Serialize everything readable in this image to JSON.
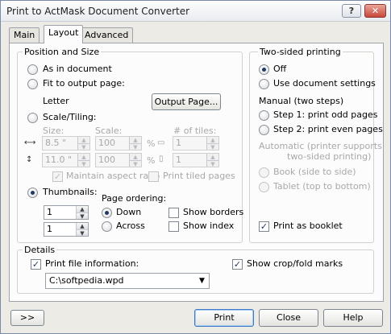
{
  "window": {
    "title": "Print to ActMask Document Converter",
    "help_label": "?",
    "close_label": "✕"
  },
  "tabs": [
    "Main",
    "Layout",
    "Advanced"
  ],
  "position_and_size": {
    "legend": "Position and Size",
    "as_in_document": "As in document",
    "fit_to_output_page": "Fit to output page:",
    "paper": "Letter",
    "output_page_button": "Output Page...",
    "scale_tiling": "Scale/Tiling:",
    "size_header": "Size:",
    "scale_header": "Scale:",
    "tiles_header": "# of tiles:",
    "width_value": "8.5 \"",
    "height_value": "11.0 \"",
    "scale_width_value": "100",
    "scale_height_value": "100",
    "percent_symbol": "%",
    "tiles_width_value": "1",
    "tiles_height_value": "1",
    "maintain_aspect_ratio": "Maintain aspect ratio",
    "print_tiled_pages": "Print tiled pages",
    "thumbnails": "Thumbnails:",
    "thumb_cols_value": "1",
    "thumb_rows_value": "1",
    "page_ordering": "Page ordering:",
    "down": "Down",
    "across": "Across",
    "show_borders": "Show borders",
    "show_index": "Show index"
  },
  "two_sided": {
    "legend": "Two-sided printing",
    "off": "Off",
    "use_document_settings": "Use document settings",
    "manual_header": "Manual (two steps)",
    "step1": "Step 1: print odd pages",
    "step2": "Step 2: print even pages",
    "automatic_line1": "Automatic (printer supports",
    "automatic_line2": "two-sided printing)",
    "book": "Book (side to side)",
    "tablet": "Tablet (top to bottom)",
    "print_as_booklet": "Print as booklet",
    "print_as_booklet_checked": true
  },
  "details": {
    "legend": "Details",
    "print_file_information": "Print file information:",
    "print_file_information_checked": true,
    "show_crop_fold_marks": "Show crop/fold marks",
    "show_crop_fold_marks_checked": true,
    "file_path": "C:\\softpedia.wpd"
  },
  "footer": {
    "more_label": ">>",
    "print_label": "Print",
    "close_label": "Close",
    "help_label": "Help"
  },
  "check_mark": "✓"
}
